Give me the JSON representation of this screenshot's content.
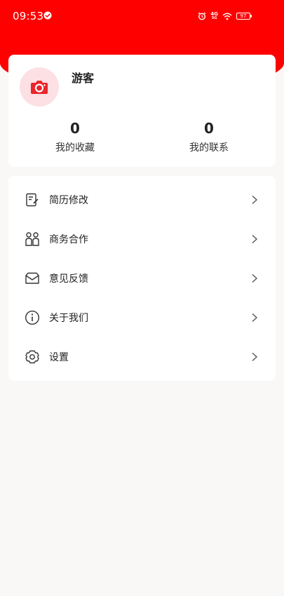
{
  "status_bar": {
    "time": "09:53",
    "network_top": "4G",
    "network_bottom": "5G",
    "battery": "97"
  },
  "profile": {
    "username": "游客",
    "avatar_icon": "camera-icon",
    "stats": [
      {
        "value": "0",
        "label": "我的收藏"
      },
      {
        "value": "0",
        "label": "我的联系"
      }
    ]
  },
  "menu": {
    "items": [
      {
        "label": "简历修改",
        "icon": "resume-edit-icon"
      },
      {
        "label": "商务合作",
        "icon": "business-people-icon"
      },
      {
        "label": "意见反馈",
        "icon": "feedback-envelope-icon"
      },
      {
        "label": "关于我们",
        "icon": "info-icon"
      },
      {
        "label": "设置",
        "icon": "settings-gear-icon"
      }
    ]
  },
  "colors": {
    "header_red": "#ff0000",
    "avatar_bg": "#fde0e3",
    "background": "#faf7f7"
  }
}
